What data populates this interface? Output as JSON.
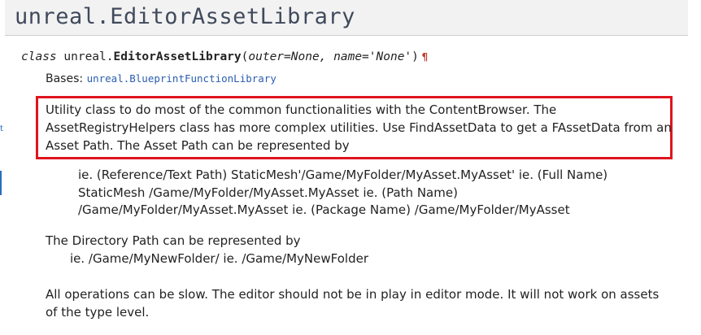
{
  "page": {
    "title": "unreal.EditorAssetLibrary",
    "left_margin_mark": "t"
  },
  "signature": {
    "keyword": "class",
    "module": "unreal.",
    "class_name": "EditorAssetLibrary",
    "open_paren": "(",
    "params": "outer=None, name='None'",
    "close_paren": ")",
    "permalink": "¶"
  },
  "bases": {
    "label": "Bases:",
    "link": "unreal.BlueprintFunctionLibrary"
  },
  "description": {
    "lines": [
      "Utility class to do most of the common functionalities with the ContentBrowser. The",
      "AssetRegistryHelpers class has more complex utilities. Use FindAssetData to get a FAssetData from an",
      "Asset Path. The Asset Path can be represented by"
    ],
    "asset_path_lines": [
      "ie. (Reference/Text Path) StaticMesh'/Game/MyFolder/MyAsset.MyAsset' ie. (Full Name)",
      "StaticMesh /Game/MyFolder/MyAsset.MyAsset ie. (Path Name)",
      "/Game/MyFolder/MyAsset.MyAsset ie. (Package Name) /Game/MyFolder/MyAsset"
    ],
    "directory_intro": "The Directory Path can be represented by",
    "directory_example": "ie. /Game/MyNewFolder/ ie. /Game/MyNewFolder",
    "note_lines": [
      "All operations can be slow. The editor should not be in play in editor mode. It will not work on assets",
      "of the type level."
    ]
  },
  "colors": {
    "highlight_border": "#e0141e",
    "link": "#2a5db0",
    "permalink": "#c0392b"
  }
}
